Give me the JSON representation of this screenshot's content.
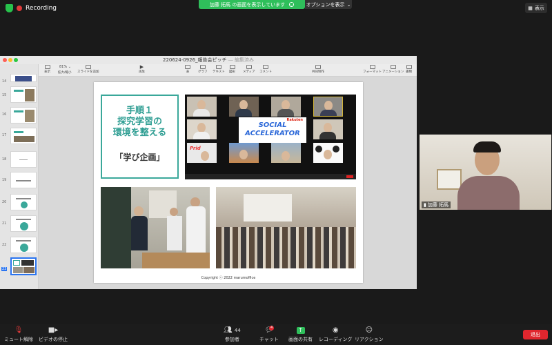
{
  "top": {
    "recording_label": "Recording",
    "share_banner": "加藤 拓馬 の画面を表示しています",
    "options_label": "オプションを表示",
    "view_label": "表示"
  },
  "keynote": {
    "title": "220624-0926_報告会ピッチ",
    "edited_status": "― 編集済み",
    "toolbar": [
      {
        "label": "表示"
      },
      {
        "label": "81%"
      },
      {
        "label": "拡大/縮小"
      },
      {
        "label": "スライドを追加"
      },
      {
        "label": "再生"
      },
      {
        "label": "表"
      },
      {
        "label": "グラフ"
      },
      {
        "label": "テキスト"
      },
      {
        "label": "図形"
      },
      {
        "label": "メディア"
      },
      {
        "label": "コメント"
      },
      {
        "label": "共同制作"
      },
      {
        "label": "フォーマット"
      },
      {
        "label": "アニメーション"
      },
      {
        "label": "書類"
      }
    ],
    "slide_numbers": [
      "14",
      "15",
      "16",
      "17",
      "18",
      "19",
      "20",
      "21",
      "22",
      "23"
    ],
    "slide": {
      "step_title": "手順１\n探究学習の\n環境を整える",
      "step_subtitle": "「学び企画」",
      "logo_line1": "SOCIAL",
      "logo_line2": "ACCELERATOR",
      "logo_brand": "Rakuten",
      "copyright": "Copyright ⓒ 2022 marumoffice"
    }
  },
  "self_video": {
    "name": "加藤 拓馬"
  },
  "bottom_bar": {
    "mute": "ミュート解除",
    "video": "ビデオの停止",
    "participants": "参加者",
    "participants_count": "44",
    "chat": "チャット",
    "chat_badge": "4",
    "share": "画面の共有",
    "record": "レコーディング",
    "reactions": "リアクション",
    "end": "退出"
  },
  "colors": {
    "accent_teal": "#3aa89a",
    "share_green": "#2fbf5b",
    "end_red": "#e0262e"
  }
}
